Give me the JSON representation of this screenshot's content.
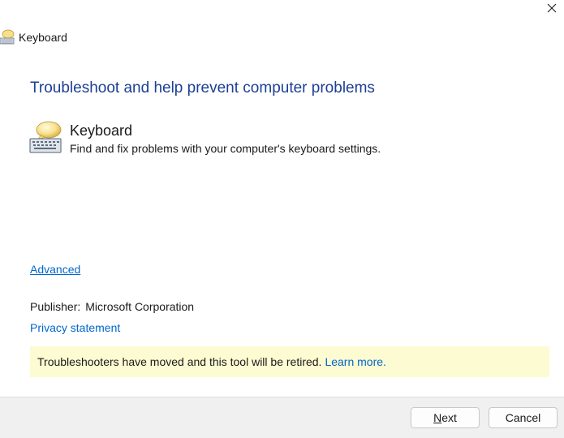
{
  "window": {
    "title": "Keyboard",
    "close_icon": "close-icon"
  },
  "main": {
    "heading": "Troubleshoot and help prevent computer problems",
    "troubleshooter": {
      "icon": "keyboard-troubleshooter-icon",
      "name": "Keyboard",
      "description": "Find and fix problems with your computer's keyboard settings."
    },
    "advanced_link": "Advanced",
    "publisher_label": "Publisher:",
    "publisher_value": "Microsoft Corporation",
    "privacy_link": "Privacy statement",
    "notice": {
      "text": "Troubleshooters have moved and this tool will be retired.",
      "link": "Learn more."
    }
  },
  "footer": {
    "next_accel": "N",
    "next_rest": "ext",
    "cancel_label": "Cancel"
  },
  "colors": {
    "heading": "#1c3f94",
    "link": "#0066cc",
    "notice_bg": "#fdfbd2",
    "footer_bg": "#f0f0f0"
  }
}
